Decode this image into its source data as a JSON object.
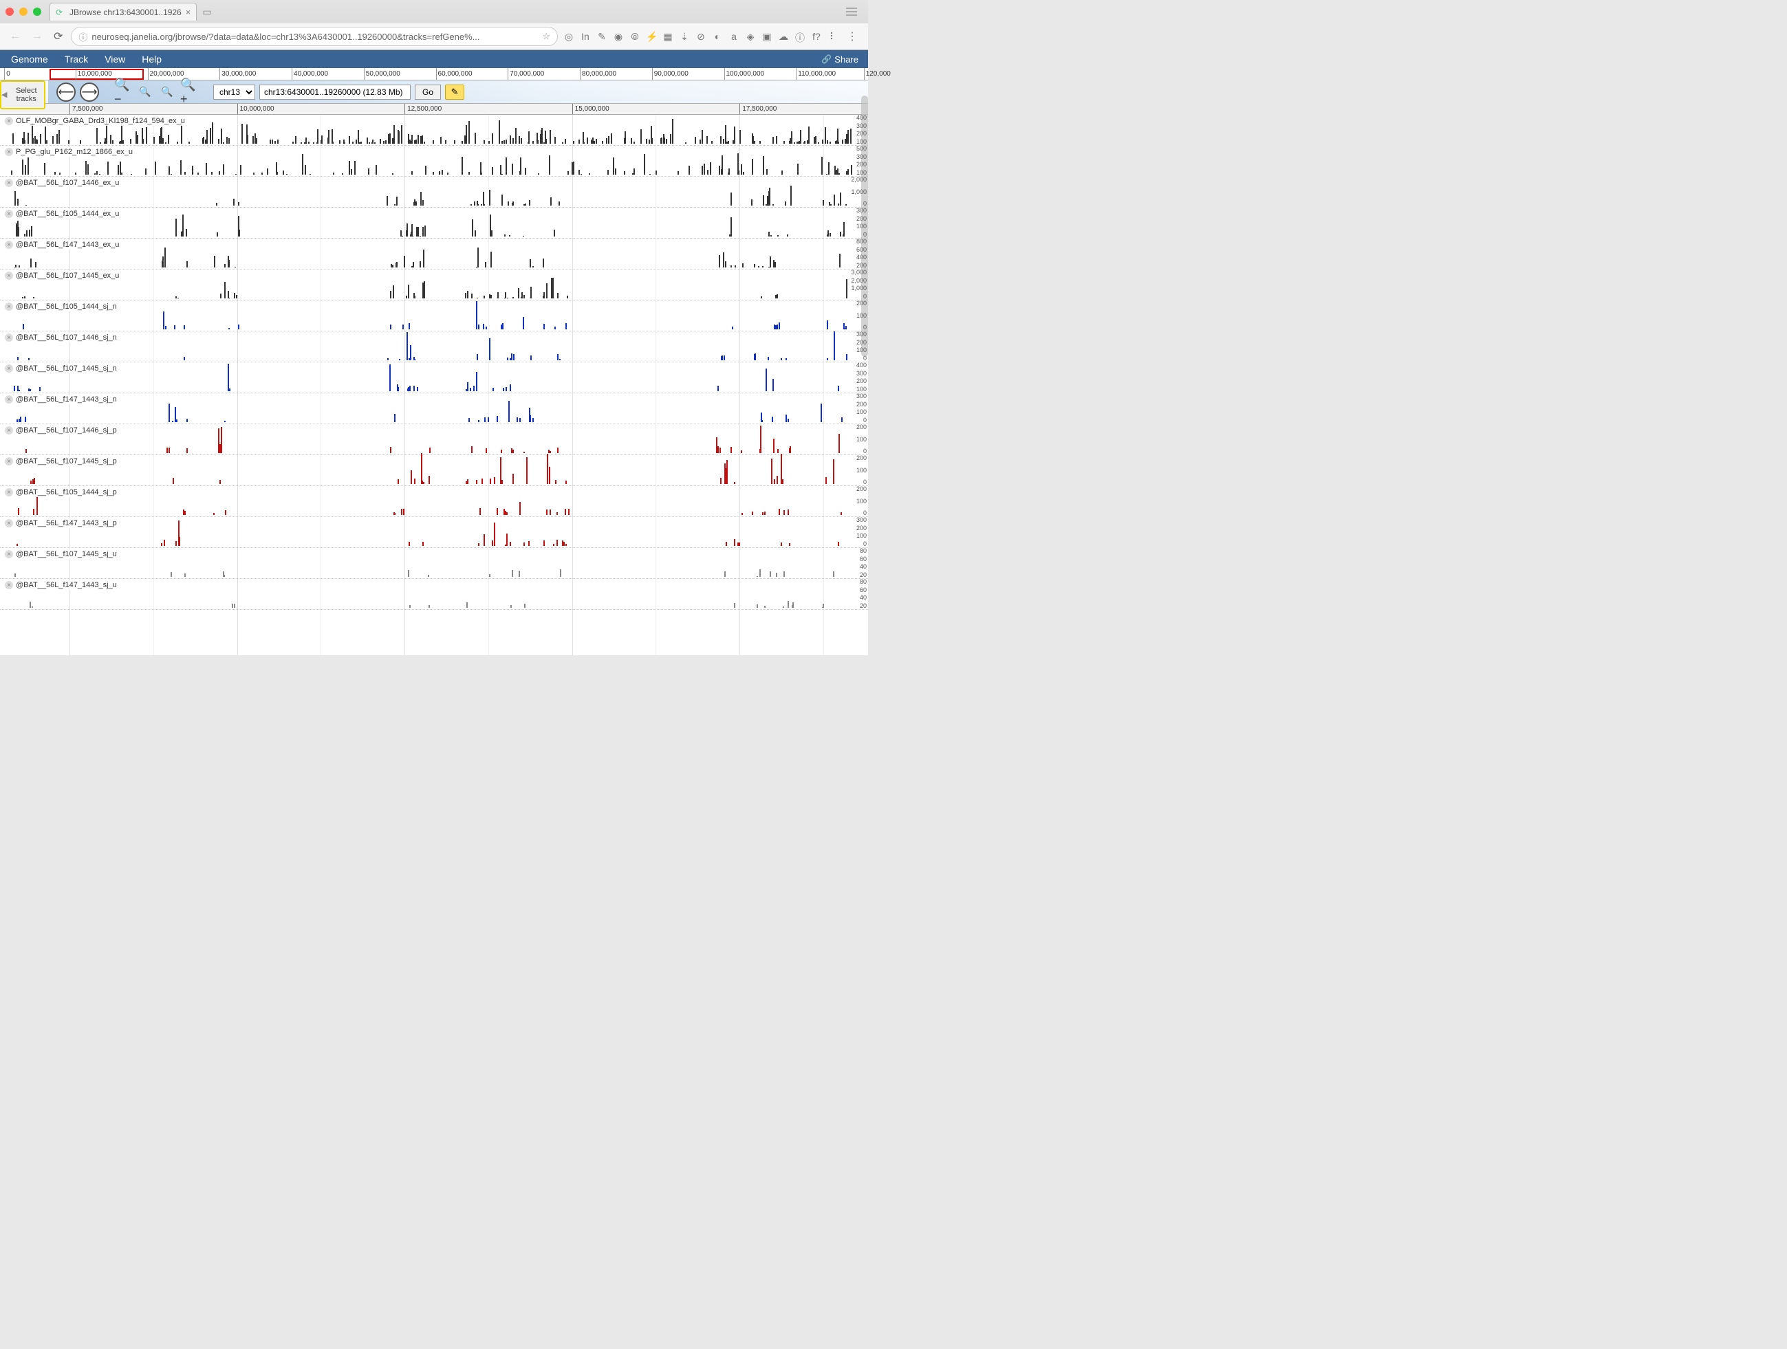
{
  "browser": {
    "tab_title": "JBrowse chr13:6430001..1926",
    "url": "neuroseq.janelia.org/jbrowse/?data=data&loc=chr13%3A6430001..19260000&tracks=refGene%...",
    "info_glyph": "ⓘ",
    "star_glyph": "☆",
    "ext_glyphs": [
      "◎",
      "In",
      "✎",
      "◉",
      "⦾",
      "⚡",
      "▦",
      "⇣",
      "⊘",
      "◐",
      "a",
      "◈",
      "▣",
      "☁",
      "ⓘ",
      "f?",
      "⠇"
    ]
  },
  "menubar": {
    "items": [
      "Genome",
      "Track",
      "View",
      "Help"
    ],
    "share": "Share"
  },
  "overview": {
    "ticks": [
      {
        "label": "0",
        "pct": 0.5
      },
      {
        "label": "10,000,000",
        "pct": 8.7
      },
      {
        "label": "20,000,000",
        "pct": 17.0
      },
      {
        "label": "30,000,000",
        "pct": 25.3
      },
      {
        "label": "40,000,000",
        "pct": 33.6
      },
      {
        "label": "50,000,000",
        "pct": 41.9
      },
      {
        "label": "60,000,000",
        "pct": 50.2
      },
      {
        "label": "70,000,000",
        "pct": 58.5
      },
      {
        "label": "80,000,000",
        "pct": 66.8
      },
      {
        "label": "90,000,000",
        "pct": 75.1
      },
      {
        "label": "100,000,000",
        "pct": 83.4
      },
      {
        "label": "110,000,000",
        "pct": 91.7
      },
      {
        "label": "120,000",
        "pct": 99.5
      }
    ],
    "highlight": {
      "left_pct": 5.7,
      "width_pct": 10.9
    }
  },
  "toolbar": {
    "select_tracks": "Select tracks",
    "chrom": "chr13",
    "location": "chr13:6430001..19260000 (12.83 Mb)",
    "go": "Go"
  },
  "track_ruler": {
    "ticks": [
      {
        "label": "7,500,000",
        "pct": 8.0
      },
      {
        "label": "10,000,000",
        "pct": 27.3
      },
      {
        "label": "12,500,000",
        "pct": 46.6
      },
      {
        "label": "15,000,000",
        "pct": 65.9
      },
      {
        "label": "17,500,000",
        "pct": 85.2
      }
    ]
  },
  "tracks": [
    {
      "name": "OLF_MOBgr_GABA_Drd3_KI198_f124_594_ex_u",
      "color": "black",
      "y": [
        "400",
        "300",
        "200",
        "100"
      ],
      "density": "dense"
    },
    {
      "name": "P_PG_glu_P162_m12_1866_ex_u",
      "color": "black",
      "y": [
        "500",
        "300",
        "200",
        "100"
      ],
      "density": "mid"
    },
    {
      "name": "@BAT__56L_f107_1446_ex_u",
      "color": "black",
      "y": [
        "2,000",
        "1,000",
        "0"
      ],
      "density": "sparse"
    },
    {
      "name": "@BAT__56L_f105_1444_ex_u",
      "color": "black",
      "y": [
        "300",
        "200",
        "100",
        "0"
      ],
      "density": "sparse"
    },
    {
      "name": "@BAT__56L_f147_1443_ex_u",
      "color": "black",
      "y": [
        "800",
        "600",
        "400",
        "200"
      ],
      "density": "sparse"
    },
    {
      "name": "@BAT__56L_f107_1445_ex_u",
      "color": "black",
      "y": [
        "3,000",
        "2,000",
        "1,000",
        "0"
      ],
      "density": "sparse"
    },
    {
      "name": "@BAT__56L_f105_1444_sj_n",
      "color": "blue",
      "y": [
        "200",
        "100",
        "0"
      ],
      "density": "peaks"
    },
    {
      "name": "@BAT__56L_f107_1446_sj_n",
      "color": "blue",
      "y": [
        "300",
        "200",
        "100",
        "0"
      ],
      "density": "peaks"
    },
    {
      "name": "@BAT__56L_f107_1445_sj_n",
      "color": "blue",
      "y": [
        "400",
        "300",
        "200",
        "100"
      ],
      "density": "peaks"
    },
    {
      "name": "@BAT__56L_f147_1443_sj_n",
      "color": "blue",
      "y": [
        "300",
        "200",
        "100",
        "0"
      ],
      "density": "peaks"
    },
    {
      "name": "@BAT__56L_f107_1446_sj_p",
      "color": "red",
      "y": [
        "200",
        "100",
        "0"
      ],
      "density": "peaks"
    },
    {
      "name": "@BAT__56L_f107_1445_sj_p",
      "color": "red",
      "y": [
        "200",
        "100",
        "0"
      ],
      "density": "peaks2"
    },
    {
      "name": "@BAT__56L_f105_1444_sj_p",
      "color": "red",
      "y": [
        "200",
        "100",
        "0"
      ],
      "density": "peaks"
    },
    {
      "name": "@BAT__56L_f147_1443_sj_p",
      "color": "red",
      "y": [
        "300",
        "200",
        "100",
        "0"
      ],
      "density": "peaks"
    },
    {
      "name": "@BAT__56L_f107_1445_sj_u",
      "color": "grey",
      "y": [
        "80",
        "60",
        "40",
        "20"
      ],
      "density": "verysparse"
    },
    {
      "name": "@BAT__56L_f147_1443_sj_u",
      "color": "grey",
      "y": [
        "80",
        "60",
        "40",
        "20"
      ],
      "density": "verysparse"
    }
  ]
}
